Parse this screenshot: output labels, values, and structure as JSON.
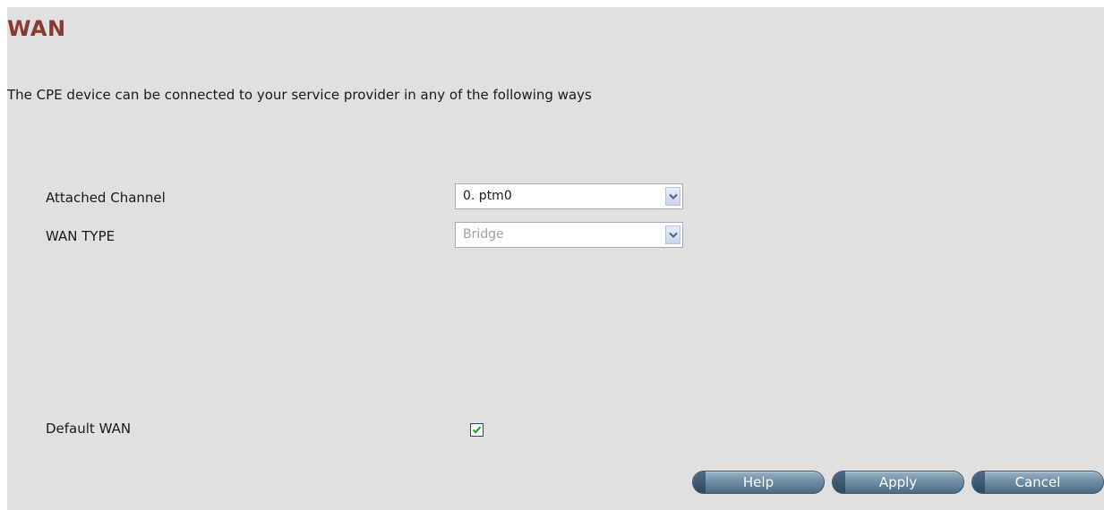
{
  "page": {
    "title": "WAN",
    "intro": "The CPE device can be connected to your service provider in any of the following ways"
  },
  "form": {
    "attached_channel": {
      "label": "Attached Channel",
      "value": "0. ptm0"
    },
    "wan_type": {
      "label": "WAN TYPE",
      "value": "Bridge",
      "disabled": true
    },
    "default_wan": {
      "label": "Default WAN",
      "checked": true
    }
  },
  "buttons": {
    "help": "Help",
    "apply": "Apply",
    "cancel": "Cancel"
  },
  "colors": {
    "title": "#8a3a32",
    "panel_background": "#e0e0e0",
    "button": "#6f8ea6"
  },
  "icons": {
    "dropdown": "chevron-down-icon",
    "checkbox": "checkmark-icon"
  }
}
